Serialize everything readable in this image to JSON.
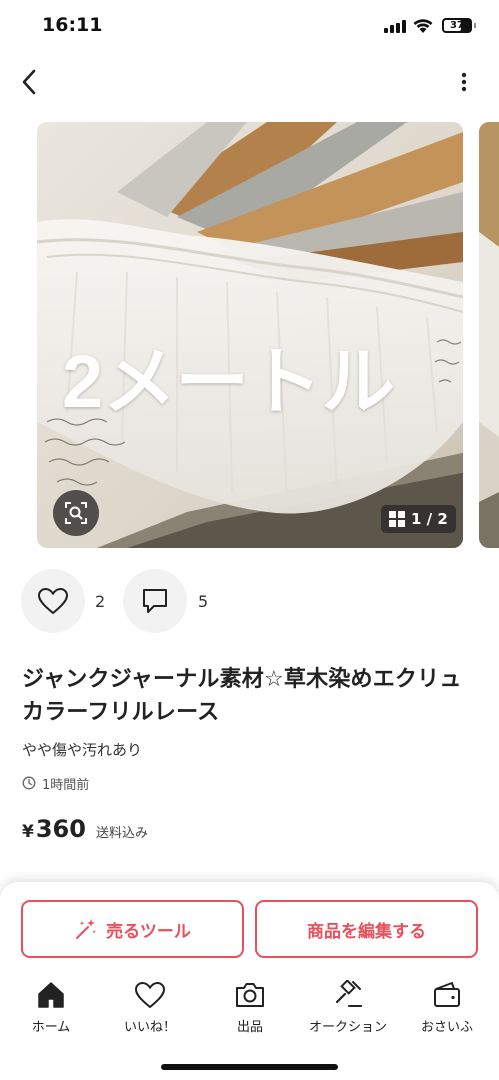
{
  "status_bar": {
    "time": "16:11",
    "battery": "37"
  },
  "header": {
    "back_icon": "chevron-left-icon",
    "more_icon": "more-vertical-icon"
  },
  "gallery": {
    "overlay_text": "2メートル",
    "page_counter": "1 / 2",
    "zoom_icon": "image-search-icon",
    "grid_icon": "grid-icon"
  },
  "actions": {
    "like_count": "2",
    "comment_count": "5"
  },
  "item": {
    "title": "ジャンクジャーナル素材☆草木染めエクリュカラーフリルレース",
    "condition": "やや傷や汚れあり",
    "posted": "1時間前",
    "price_symbol": "¥",
    "price": "360",
    "shipping": "送料込み"
  },
  "buttons": {
    "sell_tool": "売るツール",
    "edit_item": "商品を編集する"
  },
  "tabbar": {
    "items": [
      {
        "label": "ホーム",
        "icon": "home-icon"
      },
      {
        "label": "いいね！",
        "icon": "heart-icon"
      },
      {
        "label": "出品",
        "icon": "camera-icon"
      },
      {
        "label": "オークション",
        "icon": "gavel-icon"
      },
      {
        "label": "おさいふ",
        "icon": "wallet-icon"
      }
    ]
  },
  "colors": {
    "accent": "#e8505b",
    "text": "#222222",
    "circle_bg": "#f2f2f2"
  }
}
